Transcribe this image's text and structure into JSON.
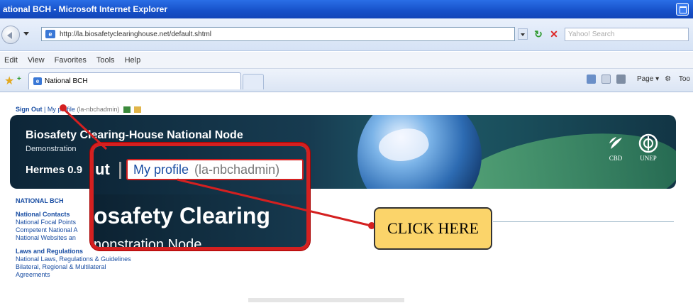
{
  "window": {
    "title": "ational BCH - Microsoft Internet Explorer"
  },
  "address": {
    "url": "http://la.biosafetyclearinghouse.net/default.shtml",
    "search_placeholder": "Yahoo! Search"
  },
  "menu": [
    "Edit",
    "View",
    "Favorites",
    "Tools",
    "Help"
  ],
  "tab": {
    "label": "National BCH"
  },
  "commands": {
    "page": "Page",
    "tools": "Too"
  },
  "signbar": {
    "sign_out": "Sign Out",
    "separator": "|",
    "my_profile": "My profile",
    "username": "(la-nbchadmin)"
  },
  "banner": {
    "title": "Biosafety Clearing-House National Node",
    "subtitle": "Demonstration",
    "version": "Hermes 0.9",
    "logo_cbd": "CBD",
    "logo_unep": "UNEP"
  },
  "leftnav": {
    "header": "NATIONAL BCH",
    "sections": [
      {
        "title": "National Contacts",
        "links": [
          "National Focal Points",
          "Competent National A",
          "National Websites an"
        ]
      },
      {
        "title": "Laws and Regulations",
        "links": [
          "National Laws, Regulations & Guidelines",
          "Bilateral, Regional & Multilateral Agreements"
        ]
      }
    ]
  },
  "zoom": {
    "ut": "ut",
    "my_profile": "My profile",
    "username": "(la-nbchadmin)",
    "title_fragment": "osafety Clearing",
    "subtitle_fragment": "nonstration Node"
  },
  "callout": {
    "label": "CLICK HERE",
    "color": "#fbd46a",
    "border_color": "#d42020"
  },
  "icons": [
    "back-icon",
    "page-icon",
    "refresh-icon",
    "stop-icon",
    "favorites-star-icon",
    "home-icon",
    "print-icon",
    "edit-profile-icon",
    "folder-icon",
    "cbd-logo-icon",
    "unep-logo-icon"
  ]
}
